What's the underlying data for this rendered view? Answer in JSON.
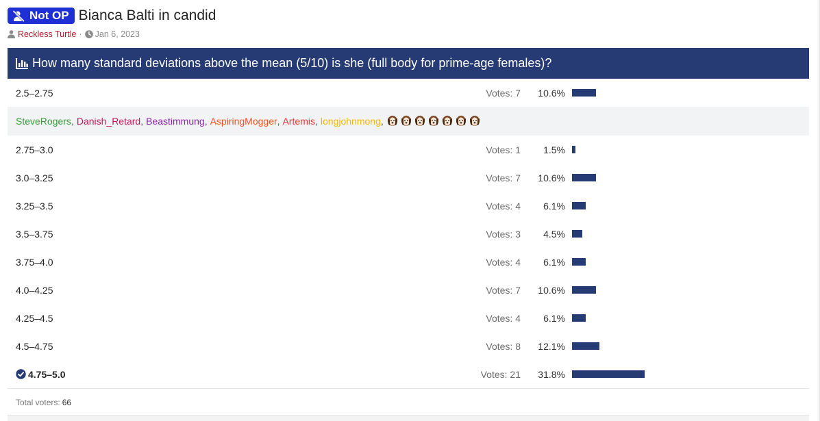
{
  "thread": {
    "prefix": "Not OP",
    "title": "Bianca Balti in candid",
    "author": "Reckless Turtle",
    "date": "Jan 6, 2023"
  },
  "poll": {
    "question": "How many standard deviations above the mean (5/10) is she (full body for prime-age females)?",
    "accent_color": "#263b73",
    "bar_max_percent": 31.8,
    "bar_max_width": 106,
    "options": [
      {
        "label": "2.5–2.75",
        "votes_text": "Votes: 7",
        "percent_text": "10.6%",
        "percent": 10.6
      },
      {
        "label": "2.75–3.0",
        "votes_text": "Votes: 1",
        "percent_text": "1.5%",
        "percent": 1.5
      },
      {
        "label": "3.0–3.25",
        "votes_text": "Votes: 7",
        "percent_text": "10.6%",
        "percent": 10.6
      },
      {
        "label": "3.25–3.5",
        "votes_text": "Votes: 4",
        "percent_text": "6.1%",
        "percent": 6.1
      },
      {
        "label": "3.5–3.75",
        "votes_text": "Votes: 3",
        "percent_text": "4.5%",
        "percent": 4.5
      },
      {
        "label": "3.75–4.0",
        "votes_text": "Votes: 4",
        "percent_text": "6.1%",
        "percent": 6.1
      },
      {
        "label": "4.0–4.25",
        "votes_text": "Votes: 7",
        "percent_text": "10.6%",
        "percent": 10.6
      },
      {
        "label": "4.25–4.5",
        "votes_text": "Votes: 4",
        "percent_text": "6.1%",
        "percent": 6.1
      },
      {
        "label": "4.5–4.75",
        "votes_text": "Votes: 8",
        "percent_text": "12.1%",
        "percent": 12.1
      },
      {
        "label": "4.75–5.0",
        "votes_text": "Votes: 21",
        "percent_text": "31.8%",
        "percent": 31.8,
        "selected": true
      }
    ],
    "voters": [
      {
        "name": "SteveRogers",
        "color": "#3a9b3a"
      },
      {
        "name": "Danish_Retard",
        "color": "#c2185b"
      },
      {
        "name": "Beastimmung",
        "color": "#8e24aa"
      },
      {
        "name": "AspiringMogger",
        "color": "#f4511e"
      },
      {
        "name": "Artemis",
        "color": "#e53935"
      },
      {
        "name": "longjohnmong",
        "color": "#f2b705"
      }
    ],
    "anonymous_voter_icon": "dog-face-icon",
    "anonymous_voter_count": 7,
    "total_label": "Total voters:",
    "total_voters": "66"
  }
}
